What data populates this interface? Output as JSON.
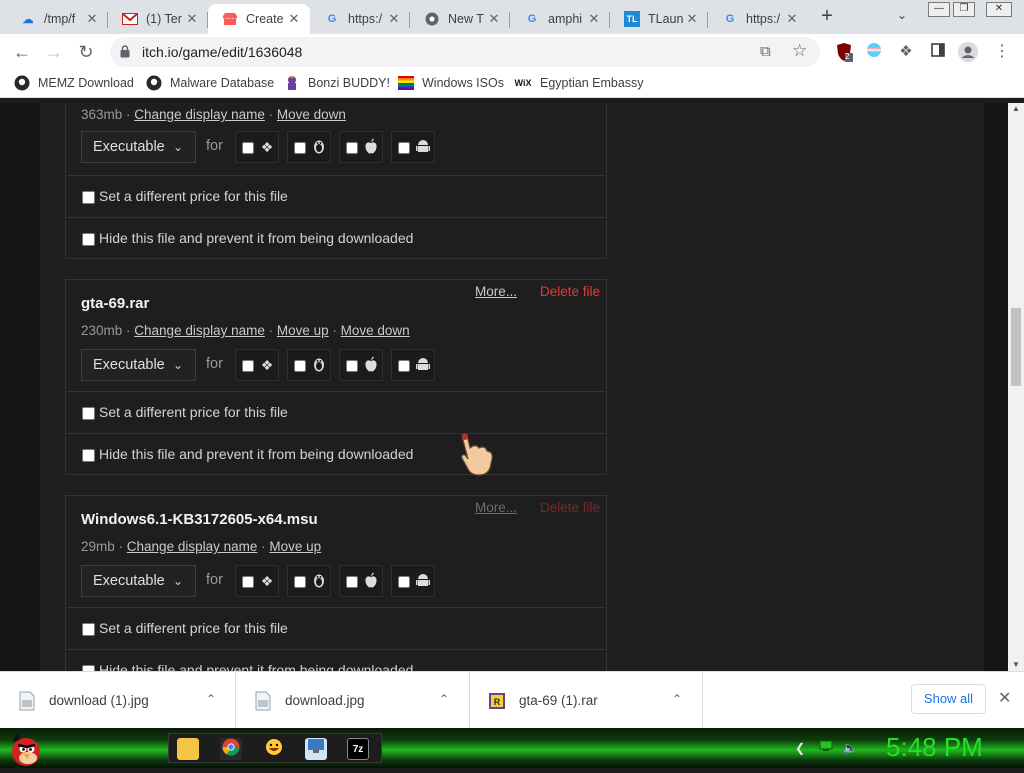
{
  "browser": {
    "tabs": [
      {
        "title": "/tmp/f",
        "icon": "upload-icon",
        "active": false
      },
      {
        "title": "(1) Ter",
        "icon": "gmail-icon",
        "active": false
      },
      {
        "title": "Create",
        "icon": "itchio-icon",
        "active": true
      },
      {
        "title": "https:/",
        "icon": "google-icon",
        "active": false
      },
      {
        "title": "New T",
        "icon": "chrome-icon",
        "active": false
      },
      {
        "title": "amphi",
        "icon": "google-icon",
        "active": false
      },
      {
        "title": "TLaun",
        "icon": "tlauncher-icon",
        "active": false
      },
      {
        "title": "https:/",
        "icon": "google-icon",
        "active": false
      }
    ],
    "url": "itch.io/game/edit/1636048",
    "extension_badge": "2",
    "bookmarks": [
      {
        "label": "MEMZ Download",
        "icon": "github-icon"
      },
      {
        "label": "Malware Database",
        "icon": "github-icon"
      },
      {
        "label": "Bonzi BUDDY!",
        "icon": "bonzi-icon"
      },
      {
        "label": "Windows ISOs",
        "icon": "rainbow-flag-icon"
      },
      {
        "label": "Egyptian Embassy",
        "icon": "wix-icon"
      }
    ]
  },
  "files": [
    {
      "name": "",
      "size": "363mb",
      "links": [
        "Change display name",
        "Move down"
      ],
      "type": "Executable",
      "for_label": "for",
      "options": [
        "Set a different price for this file",
        "Hide this file and prevent it from being downloaded"
      ]
    },
    {
      "name": "gta-69.rar",
      "size": "230mb",
      "links": [
        "Change display name",
        "Move up",
        "Move down"
      ],
      "more": "More...",
      "delete": "Delete file",
      "type": "Executable",
      "for_label": "for",
      "options": [
        "Set a different price for this file",
        "Hide this file and prevent it from being downloaded"
      ]
    },
    {
      "name": "Windows6.1-KB3172605-x64.msu",
      "size": "29mb",
      "links": [
        "Change display name",
        "Move up"
      ],
      "more": "More...",
      "delete": "Delete file",
      "type": "Executable",
      "for_label": "for",
      "options": [
        "Set a different price for this file",
        "Hide this file and prevent it from being downloaded"
      ]
    }
  ],
  "platforms": [
    "windows-icon",
    "linux-icon",
    "apple-icon",
    "android-icon"
  ],
  "downloads": {
    "items": [
      {
        "name": "download (1).jpg",
        "icon": "image-file-icon"
      },
      {
        "name": "download.jpg",
        "icon": "image-file-icon"
      },
      {
        "name": "gta-69 (1).rar",
        "icon": "rar-file-icon"
      }
    ],
    "show_all": "Show all"
  },
  "taskbar": {
    "clock": "5:48 PM",
    "apps": [
      "folder-icon",
      "chrome-icon",
      "emoji-icon",
      "monitor-icon",
      "7zip-icon"
    ],
    "seven_zip_label": "7z"
  },
  "colors": {
    "page_bg": "#1e1e1e",
    "delete_red": "#e23c3c",
    "clock_green": "#26e026",
    "link_blue": "#1a73e8"
  }
}
